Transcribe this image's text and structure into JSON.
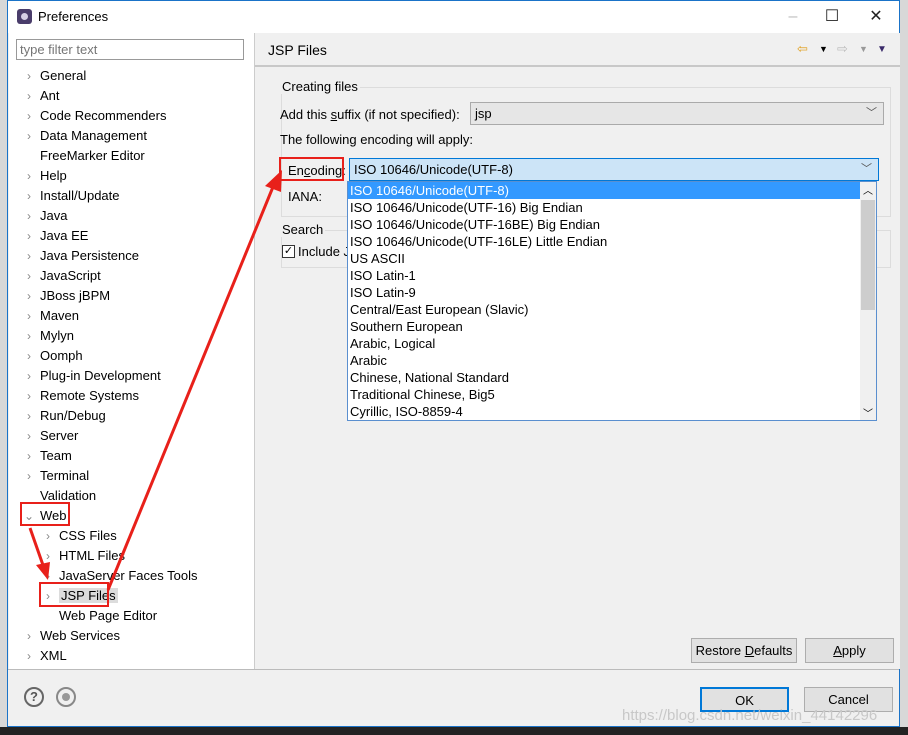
{
  "window": {
    "title": "Preferences",
    "minimize": "–",
    "maximize": "☐",
    "close": "✕"
  },
  "sidebar": {
    "filter_placeholder": "type filter text",
    "items": [
      {
        "label": "General",
        "level": 0,
        "expander": "collapsed"
      },
      {
        "label": "Ant",
        "level": 0,
        "expander": "collapsed"
      },
      {
        "label": "Code Recommenders",
        "level": 0,
        "expander": "collapsed"
      },
      {
        "label": "Data Management",
        "level": 0,
        "expander": "collapsed"
      },
      {
        "label": "FreeMarker Editor",
        "level": 0,
        "expander": "none"
      },
      {
        "label": "Help",
        "level": 0,
        "expander": "collapsed"
      },
      {
        "label": "Install/Update",
        "level": 0,
        "expander": "collapsed"
      },
      {
        "label": "Java",
        "level": 0,
        "expander": "collapsed"
      },
      {
        "label": "Java EE",
        "level": 0,
        "expander": "collapsed"
      },
      {
        "label": "Java Persistence",
        "level": 0,
        "expander": "collapsed"
      },
      {
        "label": "JavaScript",
        "level": 0,
        "expander": "collapsed"
      },
      {
        "label": "JBoss jBPM",
        "level": 0,
        "expander": "collapsed"
      },
      {
        "label": "Maven",
        "level": 0,
        "expander": "collapsed"
      },
      {
        "label": "Mylyn",
        "level": 0,
        "expander": "collapsed"
      },
      {
        "label": "Oomph",
        "level": 0,
        "expander": "collapsed"
      },
      {
        "label": "Plug-in Development",
        "level": 0,
        "expander": "collapsed"
      },
      {
        "label": "Remote Systems",
        "level": 0,
        "expander": "collapsed"
      },
      {
        "label": "Run/Debug",
        "level": 0,
        "expander": "collapsed"
      },
      {
        "label": "Server",
        "level": 0,
        "expander": "collapsed"
      },
      {
        "label": "Team",
        "level": 0,
        "expander": "collapsed"
      },
      {
        "label": "Terminal",
        "level": 0,
        "expander": "collapsed"
      },
      {
        "label": "Validation",
        "level": 0,
        "expander": "none"
      },
      {
        "label": "Web",
        "level": 0,
        "expander": "expanded"
      },
      {
        "label": "CSS Files",
        "level": 1,
        "expander": "collapsed"
      },
      {
        "label": "HTML Files",
        "level": 1,
        "expander": "collapsed"
      },
      {
        "label": "JavaServer Faces Tools",
        "level": 1,
        "expander": "collapsed"
      },
      {
        "label": "JSP Files",
        "level": 1,
        "expander": "collapsed",
        "selected": true
      },
      {
        "label": "Web Page Editor",
        "level": 1,
        "expander": "none"
      },
      {
        "label": "Web Services",
        "level": 0,
        "expander": "collapsed"
      },
      {
        "label": "XML",
        "level": 0,
        "expander": "collapsed"
      }
    ]
  },
  "page": {
    "title": "JSP Files",
    "creating_files": {
      "label": "Creating files",
      "suffix_label_pre": "Add this ",
      "suffix_label_u": "s",
      "suffix_label_post": "uffix (if not specified):",
      "suffix_value": "jsp",
      "following": "The following encoding will apply:",
      "encoding_label_pre": "En",
      "encoding_label_u": "c",
      "encoding_label_post": "oding:",
      "encoding_value": "ISO 10646/Unicode(UTF-8)",
      "iana_label": "IANA:"
    },
    "search": {
      "label": "Search",
      "include_label": "Include J",
      "include_checked": true
    },
    "encoding_options": [
      "ISO 10646/Unicode(UTF-8)",
      "ISO 10646/Unicode(UTF-16) Big Endian",
      "ISO 10646/Unicode(UTF-16BE) Big Endian",
      "ISO 10646/Unicode(UTF-16LE) Little Endian",
      "US ASCII",
      "ISO Latin-1",
      "ISO Latin-9",
      "Central/East European (Slavic)",
      "Southern European",
      "Arabic, Logical",
      "Arabic",
      "Chinese, National Standard",
      "Traditional Chinese, Big5",
      "Cyrillic, ISO-8859-4"
    ],
    "restore_pre": "Restore ",
    "restore_u": "D",
    "restore_post": "efaults",
    "apply_u": "A",
    "apply_post": "pply"
  },
  "footer": {
    "ok": "OK",
    "cancel": "Cancel"
  },
  "watermark": "https://blog.csdn.net/weixin_44142296",
  "colors": {
    "annotation": "#e8201a",
    "selection": "#3399ff"
  }
}
